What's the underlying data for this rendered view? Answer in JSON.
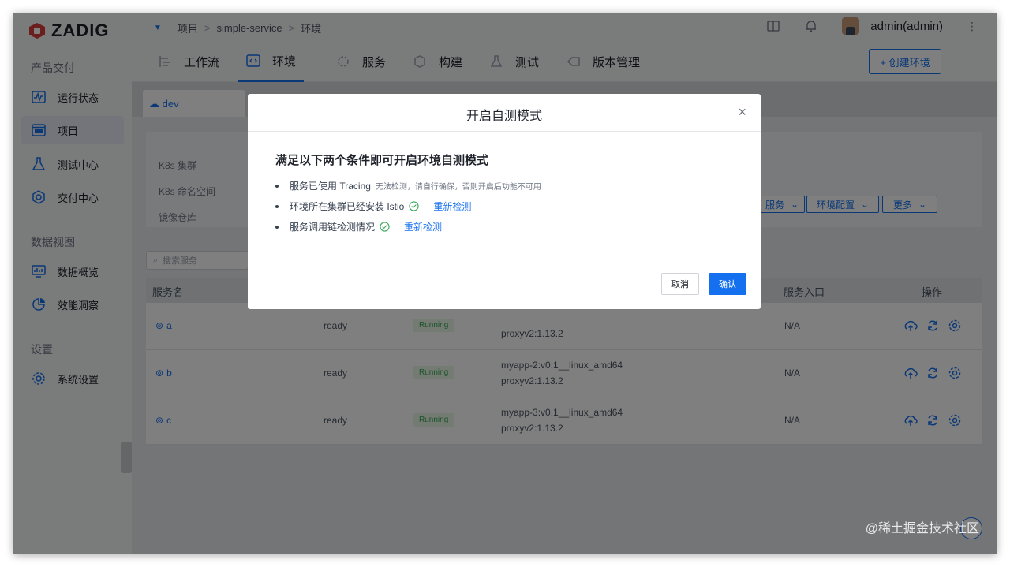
{
  "app": {
    "logo": "ZADIG"
  },
  "sidebar": {
    "sections": [
      {
        "title": "产品交付",
        "items": [
          {
            "label": "运行状态",
            "icon": "pulse-icon"
          },
          {
            "label": "项目",
            "icon": "project-icon",
            "active": true
          },
          {
            "label": "测试中心",
            "icon": "flask-icon"
          },
          {
            "label": "交付中心",
            "icon": "package-icon"
          }
        ]
      },
      {
        "title": "数据视图",
        "items": [
          {
            "label": "数据概览",
            "icon": "monitor-icon"
          },
          {
            "label": "效能洞察",
            "icon": "pie-chart-icon"
          }
        ]
      },
      {
        "title": "设置",
        "items": [
          {
            "label": "系统设置",
            "icon": "gear-icon"
          }
        ]
      }
    ]
  },
  "topbar": {
    "breadcrumb": [
      "项目",
      "simple-service",
      "环境"
    ],
    "user": "admin(admin)"
  },
  "tabs": [
    {
      "label": "工作流",
      "icon": "workflow-icon"
    },
    {
      "label": "环境",
      "icon": "code-icon",
      "active": true
    },
    {
      "label": "服务",
      "icon": "service-icon"
    },
    {
      "label": "构建",
      "icon": "build-icon"
    },
    {
      "label": "测试",
      "icon": "test-icon"
    },
    {
      "label": "版本管理",
      "icon": "version-icon"
    }
  ],
  "create_env_button": "+ 创建环境",
  "env": {
    "tab": "dev",
    "labels": [
      "K8s 集群",
      "K8s 命名空间",
      "镜像仓库"
    ],
    "buttons": [
      "服务",
      "环境配置",
      "更多"
    ],
    "search_placeholder": "搜索服务"
  },
  "table": {
    "headers": {
      "name": "服务名",
      "entry": "服务入口",
      "ops": "操作"
    },
    "rows": [
      {
        "name": "a",
        "status": "ready",
        "state": "Running",
        "image1": "",
        "image2": "proxyv2:1.13.2",
        "entry": "N/A"
      },
      {
        "name": "b",
        "status": "ready",
        "state": "Running",
        "image1": "myapp-2:v0.1__linux_amd64",
        "image2": "proxyv2:1.13.2",
        "entry": "N/A"
      },
      {
        "name": "c",
        "status": "ready",
        "state": "Running",
        "image1": "myapp-3:v0.1__linux_amd64",
        "image2": "proxyv2:1.13.2",
        "entry": "N/A"
      }
    ]
  },
  "dialog": {
    "title": "开启自测模式",
    "heading": "满足以下两个条件即可开启环境自测模式",
    "conditions": [
      {
        "text": "服务已使用 Tracing",
        "note": "无法检测，请自行确保，否则开启后功能不可用"
      },
      {
        "text": "环境所在集群已经安装 Istio",
        "link": "重新检测"
      },
      {
        "text": "服务调用链检测情况",
        "link": "重新检测"
      }
    ],
    "cancel": "取消",
    "confirm": "确认"
  },
  "watermark": "@稀土掘金技术社区",
  "colors": {
    "accent": "#1570ef",
    "success": "#3aa757",
    "brand": "#d83a3a"
  }
}
